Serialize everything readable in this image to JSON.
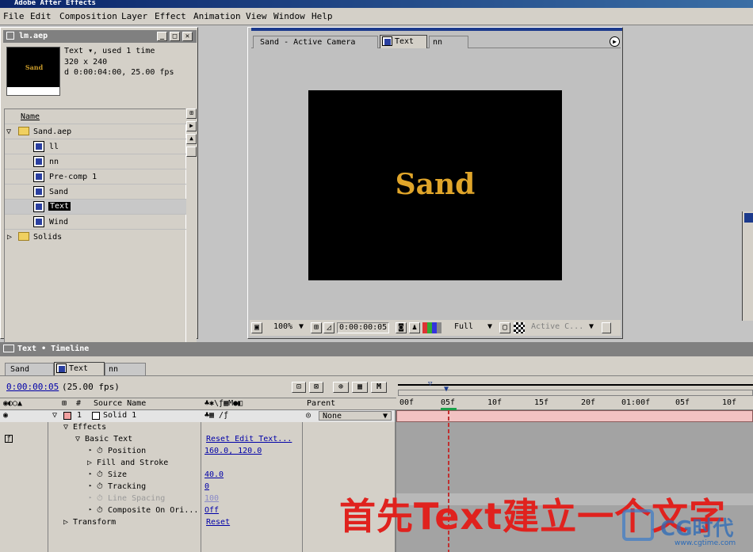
{
  "app": {
    "title": "Adobe After Effects"
  },
  "menu": [
    "File",
    "Edit",
    "Composition",
    "Layer",
    "Effect",
    "Animation",
    "View",
    "Window",
    "Help"
  ],
  "project": {
    "title": "lm.aep",
    "thumb_text": "Sand",
    "info": [
      "Text ▾, used 1 time",
      "320 x 240",
      "d 0:00:04:00, 25.00 fps"
    ],
    "column_header": "Name",
    "items": [
      {
        "label": "Sand.aep",
        "type": "folder-open"
      },
      {
        "label": "ll",
        "type": "comp"
      },
      {
        "label": "nn",
        "type": "comp"
      },
      {
        "label": "Pre-comp 1",
        "type": "comp"
      },
      {
        "label": "Sand",
        "type": "comp"
      },
      {
        "label": "Text",
        "type": "comp",
        "selected": true
      },
      {
        "label": "Wind",
        "type": "comp"
      },
      {
        "label": "Solids",
        "type": "folder"
      }
    ]
  },
  "comp": {
    "tabs": [
      "Sand - Active Camera",
      "Text",
      "nn"
    ],
    "canvas_text": "Sand",
    "zoom": "100%",
    "timecode": "0:00:00:05",
    "resolution": "Full",
    "camera": "Active C..."
  },
  "timeline": {
    "title": "Text • Timeline",
    "tabs": [
      "Sand",
      "Text",
      "nn"
    ],
    "timecode": "0:00:00:05",
    "fps": "(25.00 fps)",
    "col_num": "#",
    "col_source": "Source Name",
    "col_parent": "Parent",
    "layer": {
      "num": "1",
      "name": "Solid 1",
      "parent": "None"
    },
    "ruler": [
      "00f",
      "05f",
      "10f",
      "15f",
      "20f",
      "01:00f",
      "05f",
      "10f"
    ],
    "props": [
      {
        "label": "Effects",
        "indent": 92,
        "value": ""
      },
      {
        "label": "Basic Text",
        "indent": 107,
        "value": "Reset Edit Text..."
      },
      {
        "label": "Position",
        "indent": 136,
        "value": "160.0, 120.0"
      },
      {
        "label": "Fill and Stroke",
        "indent": 122,
        "value": ""
      },
      {
        "label": "Size",
        "indent": 136,
        "value": "40.0"
      },
      {
        "label": "Tracking",
        "indent": 136,
        "value": "0"
      },
      {
        "label": "Line Spacing",
        "indent": 136,
        "value": "100",
        "dim": true
      },
      {
        "label": "Composite On Ori...",
        "indent": 136,
        "value": "Off"
      },
      {
        "label": "Transform",
        "indent": 92,
        "value": "Reset"
      }
    ]
  },
  "overlay": {
    "caption": "首先Text建立一个文字",
    "watermark": "CG时代",
    "watermark_url": "www.cgtime.com"
  },
  "colors": {
    "accent": "#e0a52a",
    "caption": "#e0221e",
    "layer_bar": "#f2c2c2",
    "link": "#0000a8"
  }
}
